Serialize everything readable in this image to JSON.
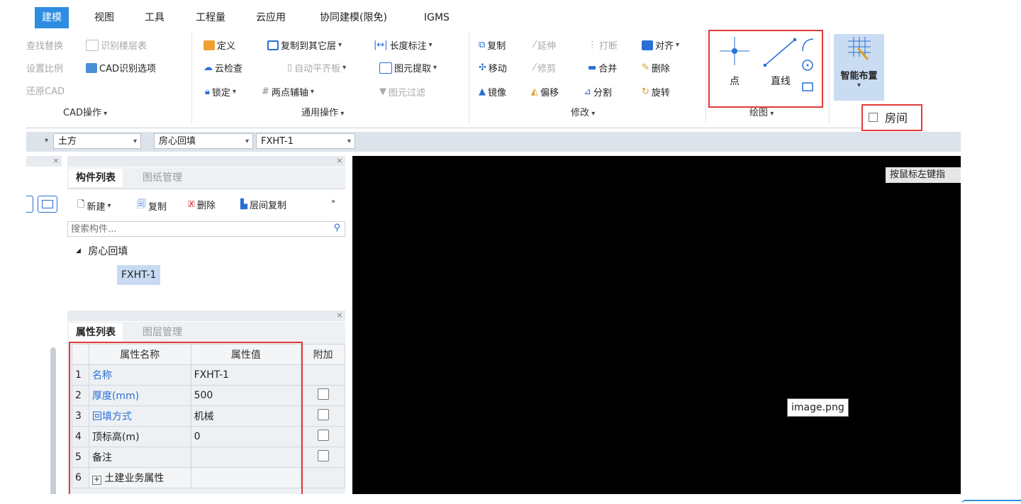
{
  "menu": [
    "建模",
    "视图",
    "工具",
    "工程量",
    "云应用",
    "协同建模(限免)",
    "IGMS"
  ],
  "cad_group": {
    "items": [
      "查找替换",
      "识别楼层表",
      "设置比例",
      "CAD识别选项",
      "还原CAD"
    ],
    "label": "CAD操作"
  },
  "general_group": {
    "items": [
      "定义",
      "复制到其它层",
      "长度标注",
      "云检查",
      "自动平齐板",
      "图元提取",
      "锁定",
      "两点辅轴",
      "图元过滤"
    ],
    "label": "通用操作"
  },
  "modify_group": {
    "items": [
      "复制",
      "延伸",
      "打断",
      "对齐",
      "移动",
      "修剪",
      "合并",
      "删除",
      "镜像",
      "偏移",
      "分割",
      "旋转"
    ],
    "label": "修改"
  },
  "draw_group": {
    "items": [
      "点",
      "直线"
    ],
    "label": "绘图"
  },
  "smart": {
    "label": "智能布置",
    "dropdown_item": "房间"
  },
  "selectors": [
    "土方",
    "房心回填",
    "FXHT-1"
  ],
  "component_panel": {
    "tabs": [
      "构件列表",
      "图纸管理"
    ],
    "toolbar": [
      "新建",
      "复制",
      "删除",
      "层间复制"
    ],
    "search_placeholder": "搜索构件...",
    "tree_parent": "房心回填",
    "tree_child": "FXHT-1"
  },
  "property_panel": {
    "tabs": [
      "属性列表",
      "图层管理"
    ],
    "headers": [
      "属性名称",
      "属性值",
      "附加"
    ],
    "rows": [
      {
        "num": "1",
        "name": "名称",
        "value": "FXHT-1"
      },
      {
        "num": "2",
        "name": "厚度(mm)",
        "value": "500"
      },
      {
        "num": "3",
        "name": "回填方式",
        "value": "机械"
      },
      {
        "num": "4",
        "name": "顶标高(m)",
        "value": "0"
      },
      {
        "num": "5",
        "name": "备注",
        "value": ""
      },
      {
        "num": "6",
        "name": "土建业务属性",
        "value": ""
      }
    ]
  },
  "canvas": {
    "hint": "按鼠标左键指",
    "tooltip": "image.png"
  },
  "colors": {
    "accent": "#2e8de0",
    "highlight_box": "#e23a3a",
    "canvas": "#000000"
  }
}
